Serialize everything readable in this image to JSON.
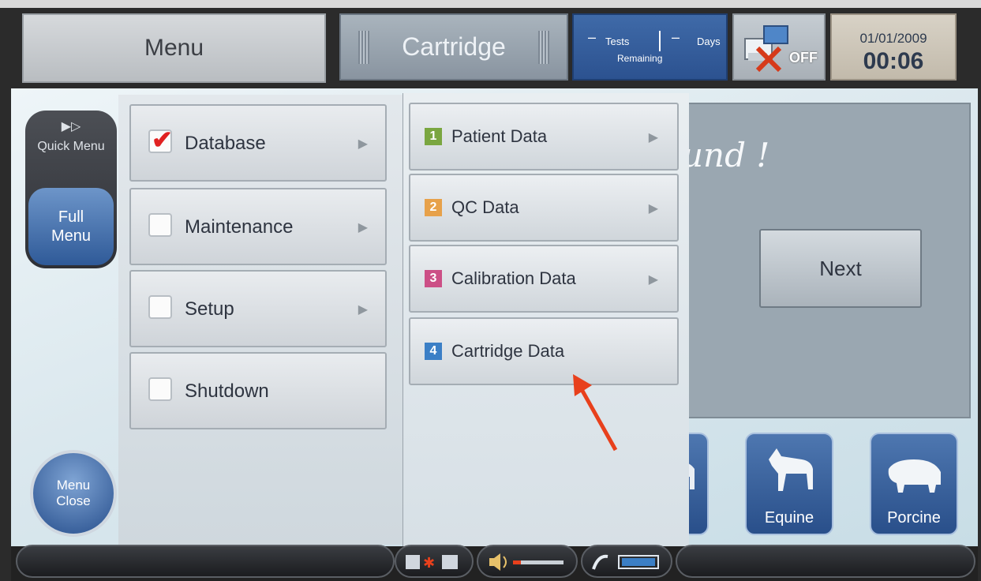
{
  "header": {
    "menu_label": "Menu",
    "cartridge_label": "Cartridge",
    "tests_label": "Tests",
    "days_label": "Days",
    "remaining_label": "Remaining",
    "tests_value": "–",
    "days_value": "–",
    "printer_status": "OFF",
    "date": "01/01/2009",
    "time": "00:06"
  },
  "sidebar": {
    "quick_arrows": "▶▷",
    "quick_menu": "Quick Menu",
    "full_menu": "Full Menu",
    "menu_close": "Menu Close"
  },
  "main_menu": {
    "items": [
      {
        "label": "Database",
        "checked": true
      },
      {
        "label": "Maintenance",
        "checked": false
      },
      {
        "label": "Setup",
        "checked": false
      },
      {
        "label": "Shutdown",
        "checked": false
      }
    ]
  },
  "submenu": {
    "items": [
      {
        "number": "1",
        "label": "Patient Data",
        "color": "#7aa640"
      },
      {
        "number": "2",
        "label": "QC Data",
        "color": "#e7a14a"
      },
      {
        "number": "3",
        "label": "Calibration Data",
        "color": "#cc4f86"
      },
      {
        "number": "4",
        "label": "Cartridge Data",
        "color": "#3b7fc6"
      }
    ]
  },
  "main": {
    "message": "und !",
    "next_label": "Next",
    "animals": [
      "Equine",
      "Porcine"
    ]
  },
  "colors": {
    "accent_blue": "#2f5a98",
    "check_red": "#e02020",
    "arrow_red": "#e8401c"
  }
}
